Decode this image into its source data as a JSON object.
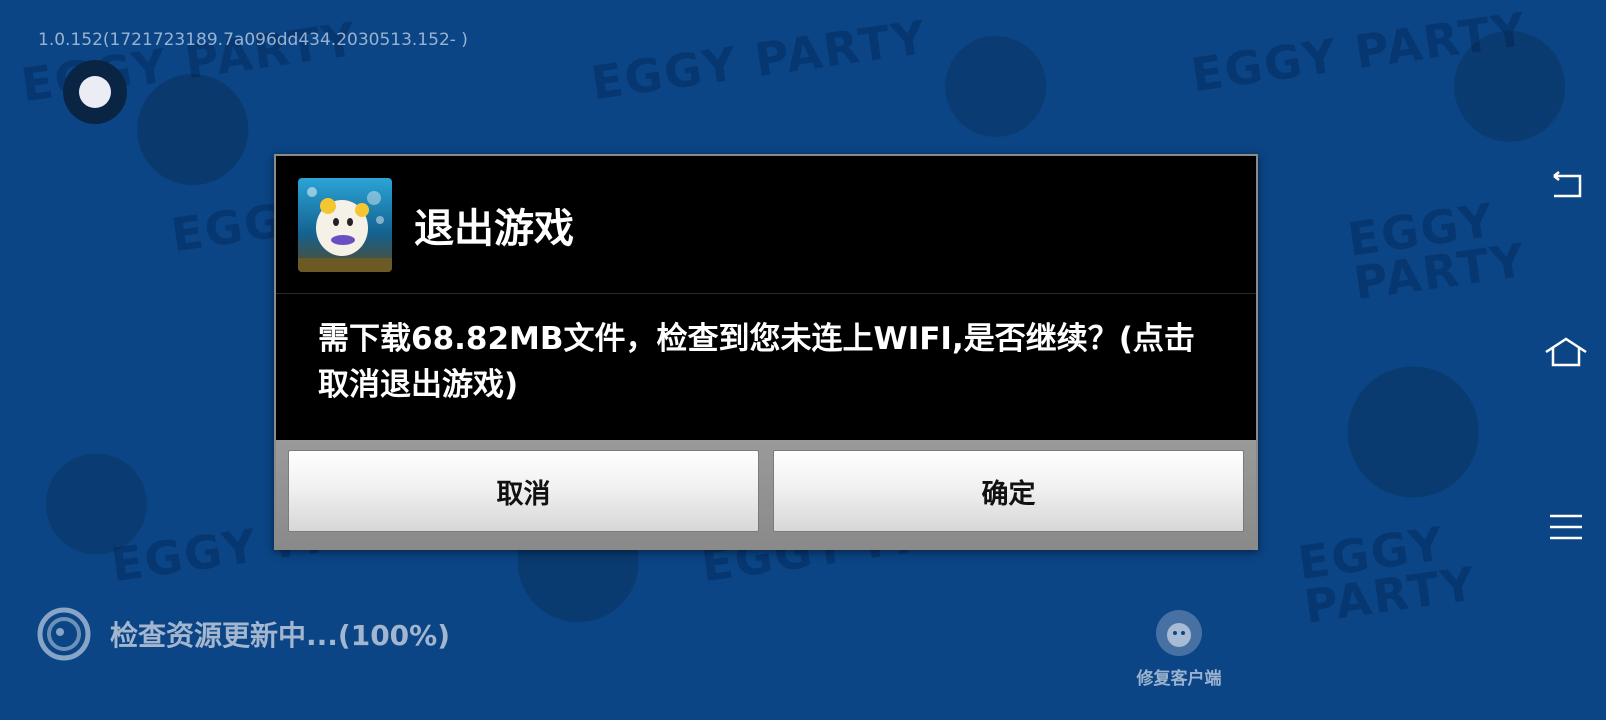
{
  "version": "1.0.152(1721723189.7a096dd434.2030513.152- )",
  "background": {
    "logo_text": "EGGY PARTY",
    "color": "#0b4585"
  },
  "status": {
    "text": "检查资源更新中...(100%)",
    "icon": "loading-ring-icon"
  },
  "repair": {
    "label": "修复客户端",
    "icon": "repair-mascot-icon"
  },
  "nav": {
    "back_icon": "back-icon",
    "home_icon": "home-icon",
    "menu_icon": "menu-icon"
  },
  "dialog": {
    "title": "退出游戏",
    "icon": "eggy-party-app-icon",
    "message": "需下载68.82MB文件，检查到您未连上WIFI,是否继续？(点击取消退出游戏)",
    "cancel_label": "取消",
    "confirm_label": "确定"
  }
}
